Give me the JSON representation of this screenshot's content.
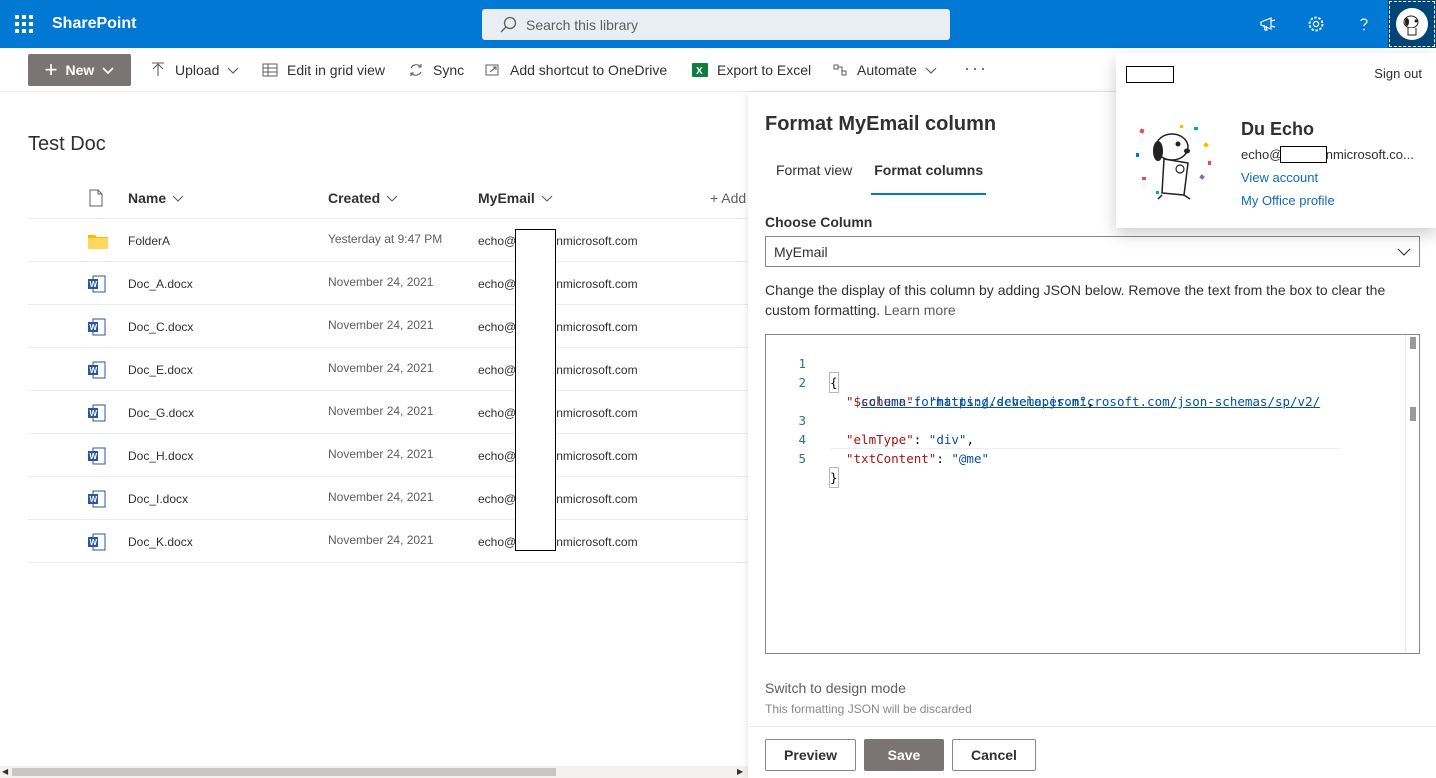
{
  "suite": {
    "app_name": "SharePoint",
    "search_placeholder": "Search this library",
    "icons": [
      "waffle-icon",
      "megaphone-icon",
      "gear-icon",
      "help-icon",
      "avatar"
    ]
  },
  "commandbar": {
    "new_label": "New",
    "upload_label": "Upload",
    "grid_label": "Edit in grid view",
    "sync_label": "Sync",
    "shortcut_label": "Add shortcut to OneDrive",
    "excel_label": "Export to Excel",
    "automate_label": "Automate",
    "more_label": "···"
  },
  "library": {
    "title": "Test Doc",
    "columns": {
      "name": "Name",
      "created": "Created",
      "myemail": "MyEmail",
      "add": "+ Add"
    },
    "rows": [
      {
        "type": "folder",
        "name": "FolderA",
        "created": "Yesterday at 9:47 PM",
        "email": "echo@          onmicrosoft.com"
      },
      {
        "type": "word",
        "name": "Doc_A.docx",
        "created": "November 24, 2021",
        "email": "echo@          onmicrosoft.com"
      },
      {
        "type": "word",
        "name": "Doc_C.docx",
        "created": "November 24, 2021",
        "email": "echo@          onmicrosoft.com"
      },
      {
        "type": "word",
        "name": "Doc_E.docx",
        "created": "November 24, 2021",
        "email": "echo@          onmicrosoft.com"
      },
      {
        "type": "word",
        "name": "Doc_G.docx",
        "created": "November 24, 2021",
        "email": "echo@          onmicrosoft.com"
      },
      {
        "type": "word",
        "name": "Doc_H.docx",
        "created": "November 24, 2021",
        "email": "echo@          onmicrosoft.com"
      },
      {
        "type": "word",
        "name": "Doc_I.docx",
        "created": "November 24, 2021",
        "email": "echo@          onmicrosoft.com"
      },
      {
        "type": "word",
        "name": "Doc_K.docx",
        "created": "November 24, 2021",
        "email": "echo@          onmicrosoft.com"
      }
    ]
  },
  "format_pane": {
    "title": "Format MyEmail column",
    "tabs": [
      "Format view",
      "Format columns"
    ],
    "active_tab": "Format columns",
    "choose_label": "Choose Column",
    "selected_column": "MyEmail",
    "help_text": "Change the display of this column by adding JSON below. Remove the text from the box to clear the custom formatting.",
    "learn_more": "Learn more",
    "code": {
      "line_numbers": [
        "1",
        "2",
        "3",
        "4",
        "5"
      ],
      "open_brace": "{",
      "schema_key": "\"$schema\"",
      "schema_value_1": "\"https://developer.microsoft.com/json-schemas/sp/v2/",
      "schema_value_2": "column-formatting.schema.json\"",
      "elm_key": "\"elmType\"",
      "elm_value": "\"div\"",
      "txt_key": "\"txtContent\"",
      "txt_value": "\"@me\"",
      "close_brace": "}"
    },
    "switch_label": "Switch to design mode",
    "switch_note": "This formatting JSON will be discarded",
    "buttons": {
      "preview": "Preview",
      "save": "Save",
      "cancel": "Cancel"
    }
  },
  "account": {
    "sign_out": "Sign out",
    "name": "Du Echo",
    "email": "echo@          onmicrosoft.co...",
    "view_account": "View account",
    "office_profile": "My Office profile"
  },
  "colors": {
    "suite_blue": "#0078d4",
    "primary_button": "#7a7574",
    "link": "#0f6cbd"
  }
}
